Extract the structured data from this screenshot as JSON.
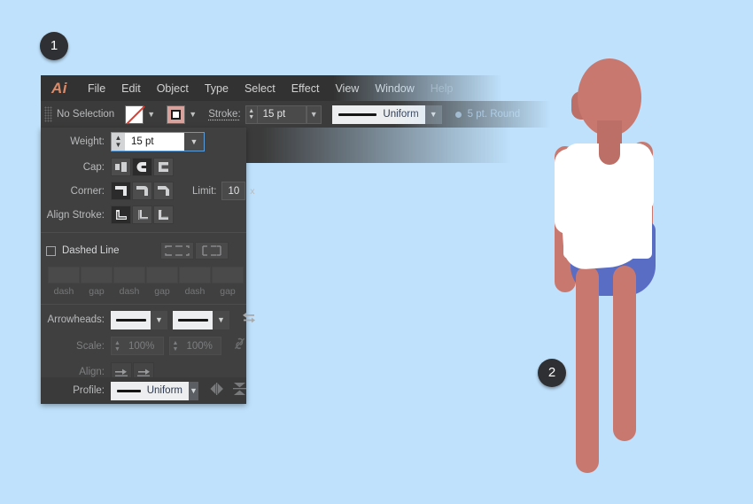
{
  "app": {
    "name": "Adobe Illustrator",
    "logo_text": "Ai",
    "background_color": "#bfe1fb",
    "panel_color": "#404040"
  },
  "menubar": {
    "items": [
      {
        "label": "File",
        "disabled": false
      },
      {
        "label": "Edit",
        "disabled": false
      },
      {
        "label": "Object",
        "disabled": false
      },
      {
        "label": "Type",
        "disabled": false
      },
      {
        "label": "Select",
        "disabled": false
      },
      {
        "label": "Effect",
        "disabled": false
      },
      {
        "label": "View",
        "disabled": false
      },
      {
        "label": "Window",
        "disabled": false
      },
      {
        "label": "Help",
        "disabled": true
      }
    ]
  },
  "control_bar": {
    "selection_status": "No Selection",
    "fill_swatch": "none-fill-swatch",
    "stroke_swatch": "stroke-color-swatch",
    "stroke_label": "Stroke:",
    "stroke_weight_value": "15 pt",
    "profile_value": "Uniform",
    "brush_value": "5 pt. Round"
  },
  "stroke_panel": {
    "weight": {
      "label": "Weight:",
      "value": "15 pt"
    },
    "cap": {
      "label": "Cap:",
      "options": [
        "butt-cap",
        "round-cap",
        "projecting-cap"
      ],
      "selected_index": 1
    },
    "corner": {
      "label": "Corner:",
      "options": [
        "miter-join",
        "round-join",
        "bevel-join"
      ],
      "selected_index": 0
    },
    "limit": {
      "label": "Limit:",
      "value": "10",
      "unit": "x"
    },
    "align_stroke": {
      "label": "Align Stroke:",
      "options": [
        "align-center",
        "align-inside",
        "align-outside"
      ],
      "selected_index": 0
    },
    "dashed_line": {
      "label": "Dashed Line",
      "checked": false,
      "align_buttons": [
        "dashes-preserve-exact",
        "dashes-adjust-to-corners"
      ],
      "fields": [
        {
          "value": "",
          "caption": "dash"
        },
        {
          "value": "",
          "caption": "gap"
        },
        {
          "value": "",
          "caption": "dash"
        },
        {
          "value": "",
          "caption": "gap"
        },
        {
          "value": "",
          "caption": "dash"
        },
        {
          "value": "",
          "caption": "gap"
        }
      ]
    },
    "arrowheads": {
      "label": "Arrowheads:",
      "start_value": "None",
      "end_value": "None",
      "swap_icon": "swap-arrowheads-icon"
    },
    "scale": {
      "label": "Scale:",
      "start_value": "100%",
      "end_value": "100%",
      "link_icon": "link-broken-icon"
    },
    "align": {
      "label": "Align:",
      "options": [
        "extend-arrow-beyond-end",
        "place-arrow-at-end"
      ]
    },
    "profile": {
      "label": "Profile:",
      "value": "Uniform",
      "flip_across_icon": "flip-across-icon",
      "flip_along_icon": "flip-along-icon"
    }
  },
  "callouts": [
    {
      "number": "1",
      "name": "callout-badge-1"
    },
    {
      "number": "2",
      "name": "callout-badge-2"
    }
  ],
  "illustration": {
    "name": "standing-person-illustration",
    "skin_color": "#c8786f",
    "shirt_color": "#ffffff",
    "shorts_color": "#5a6dc4"
  }
}
